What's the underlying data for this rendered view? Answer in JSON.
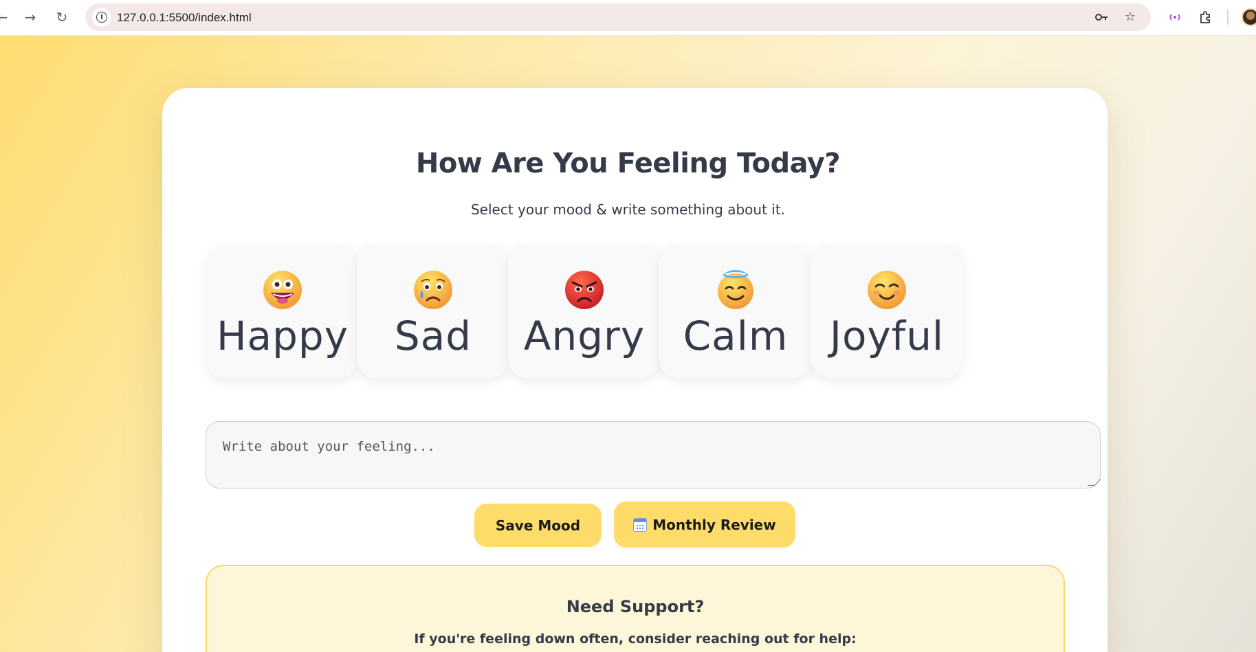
{
  "browser": {
    "url": "127.0.0.1:5500/index.html",
    "info_icon": "info-icon",
    "back_icon": "back-arrow-icon",
    "forward_icon": "forward-arrow-icon",
    "reload_icon": "reload-icon"
  },
  "page": {
    "title": "How Are You Feeling Today?",
    "subtitle": "Select your mood & write something about it."
  },
  "moods": [
    {
      "label": "Happy",
      "emoji": "grinning-face",
      "color": "#f8b84e"
    },
    {
      "label": "Sad",
      "emoji": "sad-tear-face",
      "color": "#f8b84e"
    },
    {
      "label": "Angry",
      "emoji": "angry-face",
      "color": "#e0322a"
    },
    {
      "label": "Calm",
      "emoji": "halo-face",
      "color": "#f8b84e"
    },
    {
      "label": "Joyful",
      "emoji": "smiling-face",
      "color": "#f8b84e"
    }
  ],
  "feeling_input": {
    "placeholder": "Write about your feeling...",
    "value": ""
  },
  "actions": {
    "save_label": "Save Mood",
    "review_label": "Monthly Review"
  },
  "support": {
    "title": "Need Support?",
    "text": "If you're feeling down often, consider reaching out for help:"
  },
  "colors": {
    "accent": "#fddc6a",
    "support_bg": "#fef6d8",
    "support_border": "#fbd867",
    "text": "#343a48"
  }
}
